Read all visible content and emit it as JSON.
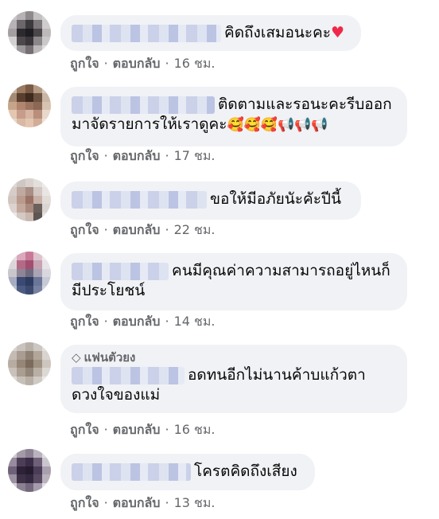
{
  "comments": [
    {
      "text": "คิดถึงเสมอนะคะ",
      "emoji": "♥",
      "like": "ถูกใจ",
      "reply": "ตอบกลับ",
      "time": "16 ชม."
    },
    {
      "text_line1": "ติดตามและรอนะคะรีบออก",
      "text_line2": "มาจัดรายการให้เราดูคะ",
      "emoji": "🥰🥰🥰📢📢📢",
      "like": "ถูกใจ",
      "reply": "ตอบกลับ",
      "time": "17 ชม."
    },
    {
      "text": "ขอให้มีอภัยนัะคัะปีนี้",
      "like": "ถูกใจ",
      "reply": "ตอบกลับ",
      "time": "22 ชม."
    },
    {
      "text_line1": "คนมีคุณค่าความสามารถอยู่ไหนก็",
      "text_line2": "มีประโยชน์",
      "like": "ถูกใจ",
      "reply": "ตอบกลับ",
      "time": "14 ชม."
    },
    {
      "badge": "แฟนตัวยง",
      "badge_icon": "diamond-icon",
      "text_line1": "อดทนอีกไม่นานค้าบแก้วตา",
      "text_line2": "ดวงใจของแม่",
      "like": "ถูกใจ",
      "reply": "ตอบกลับ",
      "time": "16 ชม."
    },
    {
      "text": "โครตคิดถึงเสียง",
      "like": "ถูกใจ",
      "reply": "ตอบกลับ",
      "time": "13 ชม."
    }
  ],
  "separator": "·",
  "colors": {
    "bubble": "#f0f2f5",
    "meta": "#65676b",
    "heart": "#f02849"
  }
}
